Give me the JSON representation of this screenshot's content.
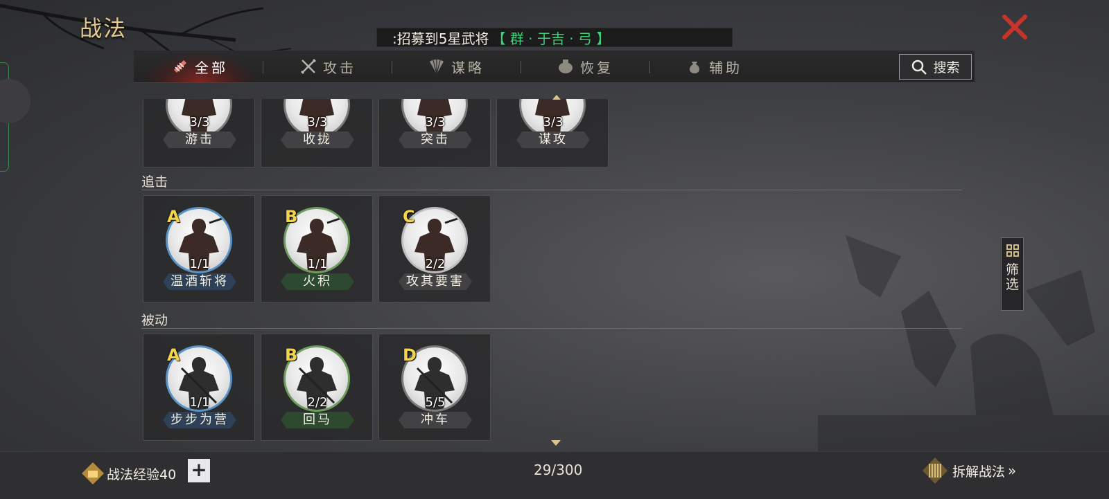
{
  "title": "战法",
  "ticker": {
    "text": ":招募到5星武将",
    "highlight": "【 群 · 于吉 · 弓 】"
  },
  "tabs": [
    {
      "label": "全部",
      "icon": "scroll-icon"
    },
    {
      "label": "攻击",
      "icon": "crossed-swords-icon"
    },
    {
      "label": "谋略",
      "icon": "fan-icon"
    },
    {
      "label": "恢复",
      "icon": "medicine-icon"
    },
    {
      "label": "辅助",
      "icon": "pouch-icon"
    }
  ],
  "active_tab": "全部",
  "search_label": "搜索",
  "filter_label": "筛选",
  "sections": {
    "top": {
      "cards": [
        {
          "count": "3/3",
          "name": "游击"
        },
        {
          "count": "3/3",
          "name": "收拢"
        },
        {
          "count": "3/3",
          "name": "突击"
        },
        {
          "count": "3/3",
          "name": "谋攻"
        }
      ]
    },
    "pursuit": {
      "label": "追击",
      "cards": [
        {
          "grade": "A",
          "count": "1/1",
          "name": "温酒斩将"
        },
        {
          "grade": "B",
          "count": "1/1",
          "name": "火积"
        },
        {
          "grade": "C",
          "count": "2/2",
          "name": "攻其要害"
        }
      ]
    },
    "passive": {
      "label": "被动",
      "cards": [
        {
          "grade": "A",
          "count": "1/1",
          "name": "步步为营"
        },
        {
          "grade": "B",
          "count": "2/2",
          "name": "回马"
        },
        {
          "grade": "D",
          "count": "5/5",
          "name": "冲车"
        }
      ]
    }
  },
  "footer": {
    "exp_label": "战法经验40",
    "plus": "+",
    "counter": "29/300",
    "dismantle_label": "拆解战法",
    "chevron": "»"
  },
  "colors": {
    "grade_text": "#f4d44a",
    "grade_a_ring": "#5a93c8",
    "grade_b_ring": "#6e9e5e",
    "grade_c_ring": "#bdbdbd",
    "grade_d_ring": "#7a7a7a",
    "ticker_highlight": "#3fd07a",
    "title": "#e2c98e",
    "close": "#c8342a"
  }
}
